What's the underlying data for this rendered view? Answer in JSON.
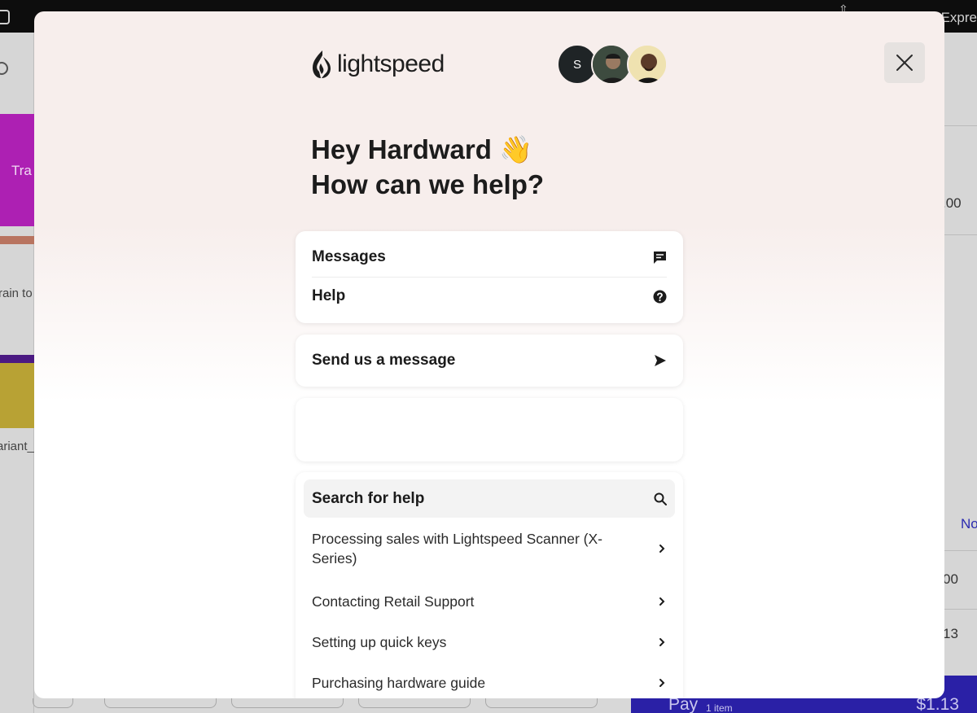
{
  "background": {
    "topbar_right_text": "Expre",
    "tile_text": "Tra",
    "train_text": "rain to",
    "variant_text": "ariant_",
    "right_amounts": [
      ".00",
      "No",
      "00",
      "13"
    ],
    "paybar": {
      "pay_label": "Pay",
      "items_label": "1 item",
      "total": "$1.13"
    }
  },
  "modal": {
    "logo_text": "lightspeed",
    "avatar_initial": "S",
    "greeting_line1": "Hey Hardward 👋",
    "greeting_line2": "How can we help?",
    "nav": {
      "messages_label": "Messages",
      "help_label": "Help"
    },
    "send_message_label": "Send us a message",
    "search_label": "Search for help",
    "articles": [
      "Processing sales with Lightspeed Scanner (X-Series)",
      "Contacting Retail Support",
      "Setting up quick keys",
      "Purchasing hardware guide"
    ]
  },
  "colors": {
    "modal_top": "#f7eeec",
    "pay_bar": "#2a20a6",
    "tile_purple": "#ad20b3"
  },
  "icons": {
    "close": "close-icon",
    "messages": "message-icon",
    "help": "question-circle-icon",
    "send": "send-arrow-icon",
    "search": "search-icon",
    "article": "chevron-right-icon"
  }
}
